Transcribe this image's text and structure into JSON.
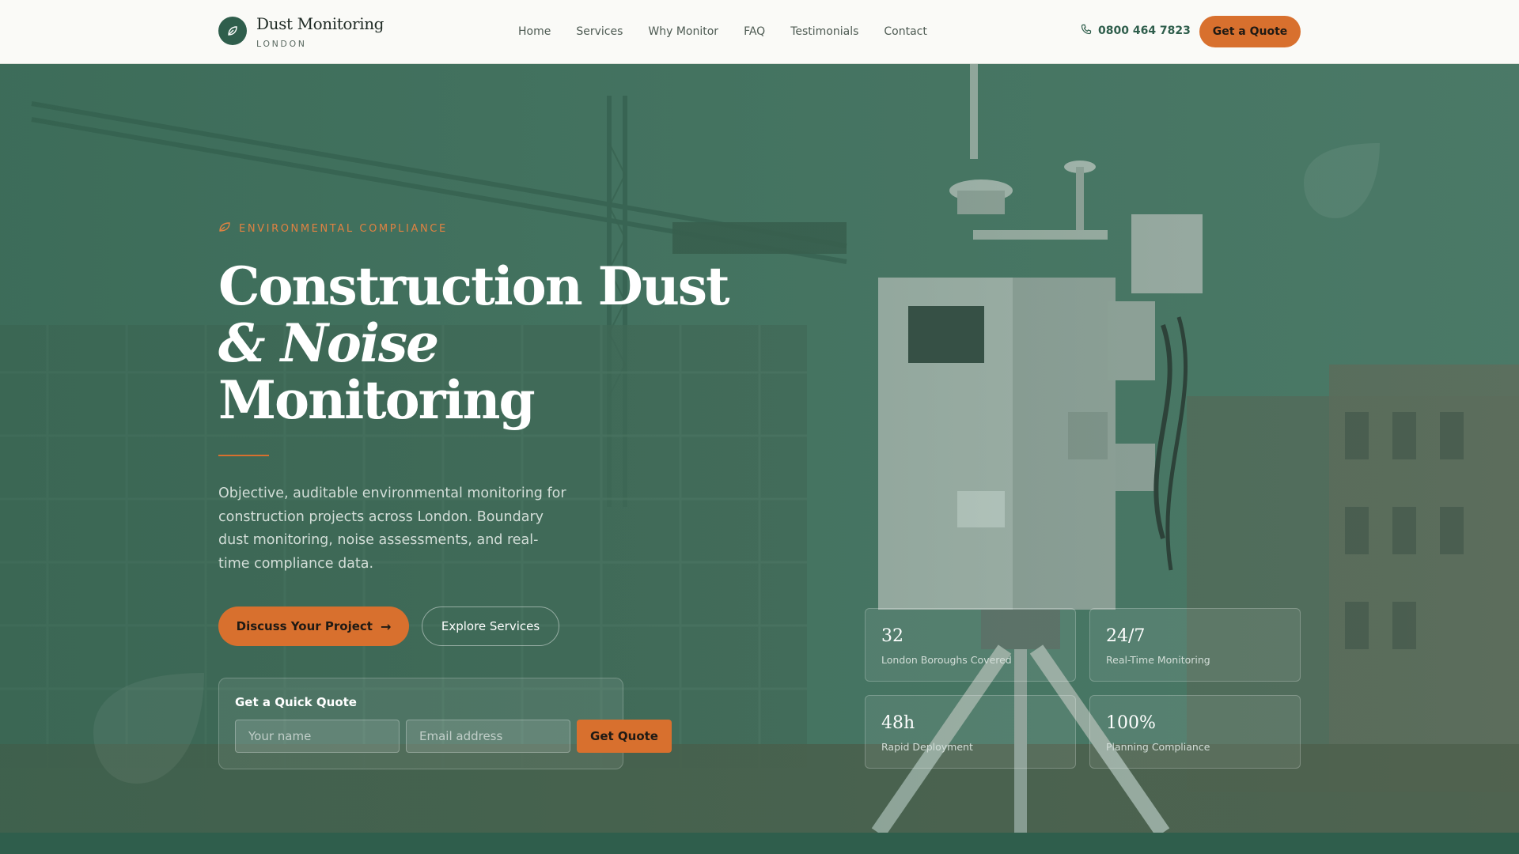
{
  "brand": {
    "name": "Dust Monitoring",
    "location": "LONDON",
    "icon": "leaf-icon"
  },
  "nav": {
    "items": [
      "Home",
      "Services",
      "Why Monitor",
      "FAQ",
      "Testimonials",
      "Contact"
    ]
  },
  "header": {
    "phone": "0800 464 7823",
    "phone_icon": "phone-icon",
    "quote_label": "Get a Quote"
  },
  "hero": {
    "eyebrow": "ENVIRONMENTAL COMPLIANCE",
    "title_line1": "Construction Dust",
    "title_line2": "& Noise",
    "title_line3": "Monitoring",
    "lead": "Objective, auditable environmental monitoring for construction projects across London. Boundary dust monitoring, noise assessments, and real-time compliance data.",
    "primary_cta": "Discuss Your Project",
    "secondary_cta": "Explore Services"
  },
  "quick_quote": {
    "title": "Get a Quick Quote",
    "name_placeholder": "Your name",
    "email_placeholder": "Email address",
    "submit_label": "Get Quote"
  },
  "stats": [
    {
      "value": "32",
      "label": "London Boroughs Covered"
    },
    {
      "value": "24/7",
      "label": "Real-Time Monitoring"
    },
    {
      "value": "48h",
      "label": "Rapid Deployment"
    },
    {
      "value": "100%",
      "label": "Planning Compliance"
    }
  ],
  "colors": {
    "brand_green": "#2f5e4c",
    "accent_orange": "#d8702e",
    "header_bg": "#fafaf7"
  }
}
